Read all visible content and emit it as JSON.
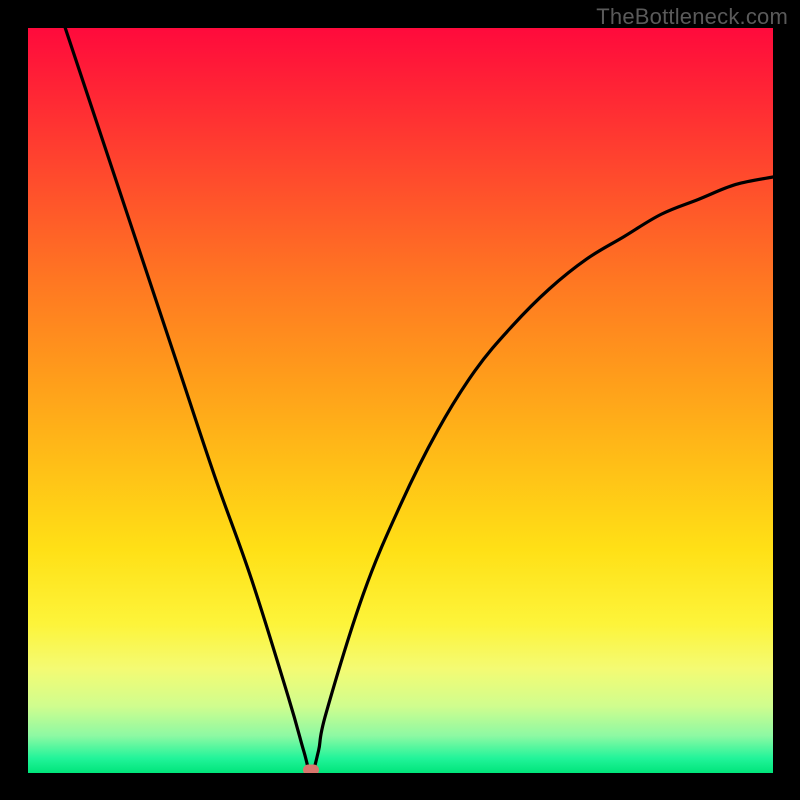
{
  "watermark": "TheBottleneck.com",
  "chart_data": {
    "type": "line",
    "title": "",
    "xlabel": "",
    "ylabel": "",
    "xlim": [
      0,
      100
    ],
    "ylim": [
      0,
      100
    ],
    "grid": false,
    "legend": false,
    "series": [
      {
        "name": "curve",
        "x": [
          5,
          10,
          15,
          20,
          25,
          30,
          35,
          37,
          38,
          39,
          40,
          45,
          50,
          55,
          60,
          65,
          70,
          75,
          80,
          85,
          90,
          95,
          100
        ],
        "values": [
          100,
          85,
          70,
          55,
          40,
          26,
          10,
          3,
          0,
          3,
          8,
          24,
          36,
          46,
          54,
          60,
          65,
          69,
          72,
          75,
          77,
          79,
          80
        ]
      }
    ],
    "dip_point": {
      "x": 38,
      "y": 0
    },
    "gradient_colors": {
      "top": "#ff0a3c",
      "mid": "#ffe016",
      "bottom": "#00e57a"
    }
  }
}
